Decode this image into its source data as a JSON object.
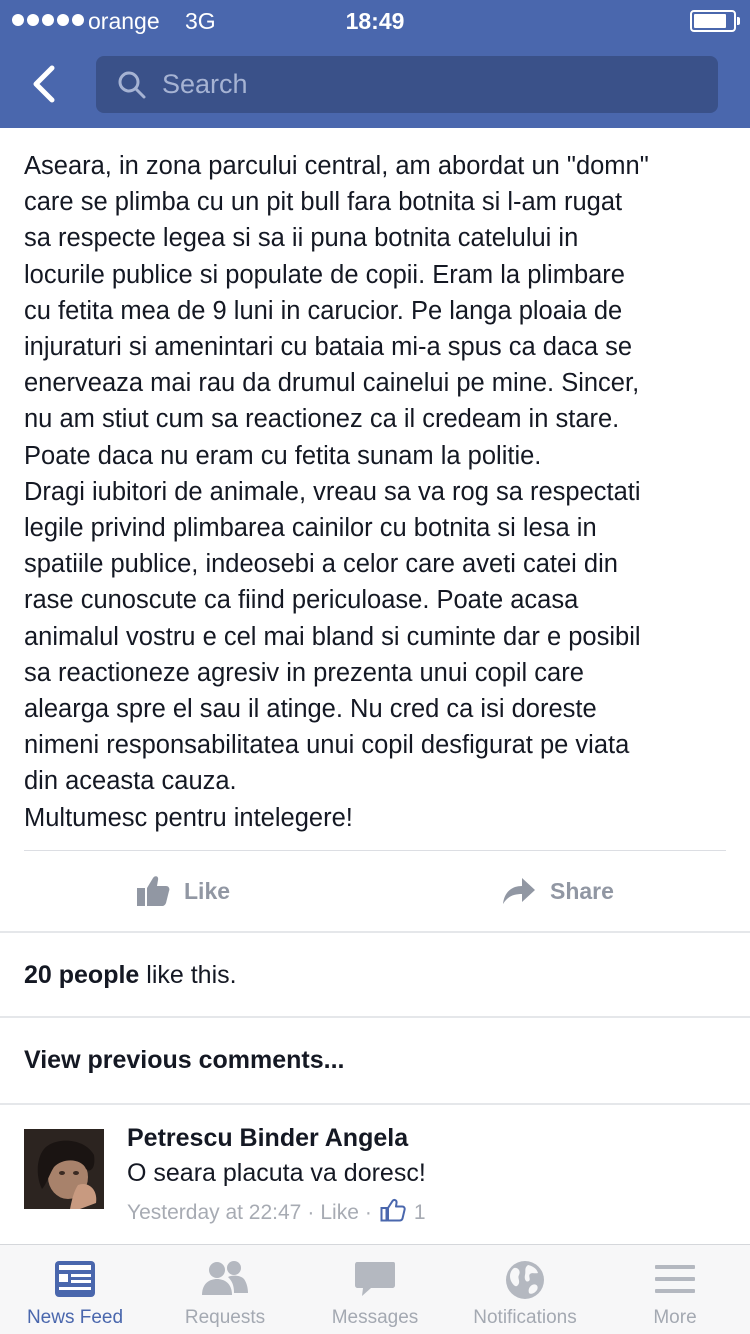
{
  "status_bar": {
    "carrier": "orange",
    "network": "3G",
    "time": "18:49"
  },
  "search": {
    "placeholder": "Search"
  },
  "post": {
    "lines": [
      "Aseara, in zona parcului central, am abordat un \"domn\"",
      "care se plimba cu un pit bull fara botnita si l-am rugat",
      "sa respecte legea si sa ii puna botnita catelului in",
      "locurile publice si populate de copii. Eram la plimbare",
      "cu fetita mea de 9 luni in carucior. Pe langa ploaia de",
      "injuraturi si amenintari cu bataia mi-a spus ca daca se",
      "enerveaza mai rau da drumul cainelui pe mine. Sincer,",
      "nu am stiut cum sa reactionez ca il credeam in stare.",
      "Poate daca nu eram cu fetita sunam la politie.",
      "Dragi iubitori de animale, vreau sa va rog sa respectati",
      "legile privind plimbarea cainilor cu botnita si lesa in",
      "spatiile publice, indeosebi a celor care aveti catei din",
      "rase cunoscute ca fiind periculoase. Poate acasa",
      "animalul vostru e cel mai bland si cuminte dar e posibil",
      "sa reactioneze agresiv in prezenta unui copil care",
      "alearga spre el sau il atinge. Nu cred ca isi doreste",
      "nimeni responsabilitatea unui copil desfigurat pe viata",
      "din aceasta cauza.",
      "Multumesc pentru intelegere!"
    ],
    "actions": {
      "like_label": "Like",
      "share_label": "Share"
    },
    "likes": {
      "count_text": "20 people",
      "suffix": " like this."
    },
    "view_previous": "View previous comments..."
  },
  "comment": {
    "author": "Petrescu Binder Angela",
    "text": "O seara placuta va doresc!",
    "time": "Yesterday at 22:47",
    "separator": "·",
    "like_label": "Like",
    "like_count": "1"
  },
  "tabbar": {
    "active_color": "#4a67ad",
    "inactive_color": "#a4a9b2",
    "items": [
      {
        "label": "News Feed",
        "icon": "news-feed-icon"
      },
      {
        "label": "Requests",
        "icon": "requests-icon"
      },
      {
        "label": "Messages",
        "icon": "messages-icon"
      },
      {
        "label": "Notifications",
        "icon": "globe-icon"
      },
      {
        "label": "More",
        "icon": "hamburger-icon"
      }
    ]
  },
  "colors": {
    "header": "#4a67ad",
    "search_bg": "#3a5189",
    "muted": "#9197a3"
  }
}
